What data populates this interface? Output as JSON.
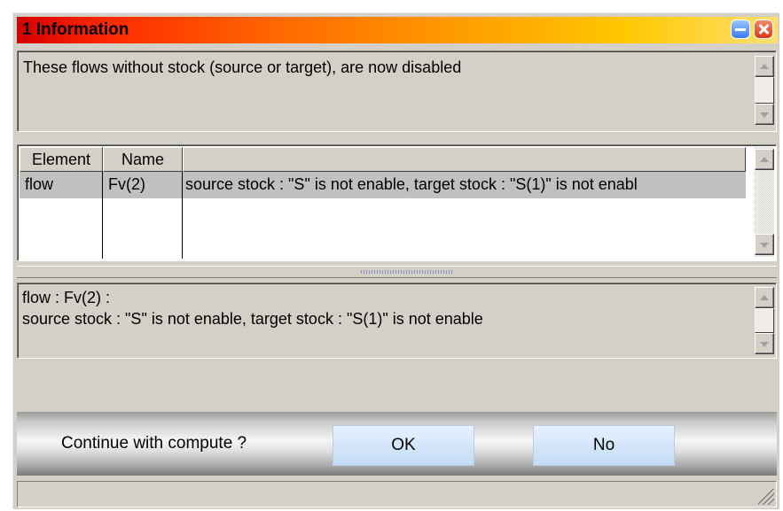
{
  "window": {
    "title": "1  Information"
  },
  "message": {
    "text": "These flows without stock (source or target), are now disabled"
  },
  "table": {
    "columns": [
      "Element",
      "Name",
      ""
    ],
    "rows": [
      [
        "flow",
        "Fv(2)",
        "source stock : \"S\"  is not enable, target stock : \"S(1)\"  is not enabl"
      ]
    ]
  },
  "detail": {
    "text": "flow : Fv(2) :\nsource stock : \"S\"  is not enable, target stock : \"S(1)\"  is not enable"
  },
  "prompt": {
    "question": "Continue with compute ?",
    "ok_label": "OK",
    "no_label": "No"
  },
  "colors": {
    "title_gradient_start": "#d40000",
    "title_gradient_end": "#ffe070",
    "window_bg": "#d4d0c8",
    "button_bg": "#d4e6fb",
    "selected_row": "#c0c0c0"
  },
  "icons": {
    "minimize": "minimize-icon",
    "close": "close-icon",
    "scroll_up": "arrow-up-icon",
    "scroll_down": "arrow-down-icon",
    "resize": "resize-grip-icon"
  }
}
